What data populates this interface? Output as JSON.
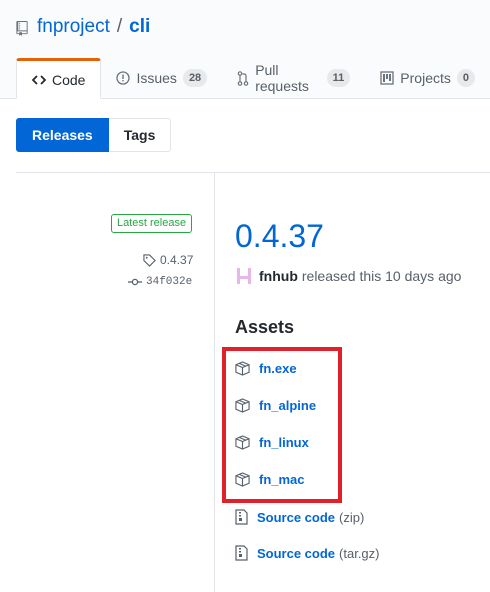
{
  "repo": {
    "owner": "fnproject",
    "separator": "/",
    "name": "cli"
  },
  "tabs": [
    {
      "label": "Code",
      "icon": "code-icon",
      "selected": true
    },
    {
      "label": "Issues",
      "count": "28",
      "icon": "issue-opened-icon"
    },
    {
      "label": "Pull requests",
      "count": "11",
      "icon": "git-pull-request-icon"
    },
    {
      "label": "Projects",
      "count": "0",
      "icon": "project-icon"
    }
  ],
  "subnav": {
    "releases": "Releases",
    "tags": "Tags"
  },
  "release": {
    "latest_label": "Latest release",
    "tag": "0.4.37",
    "commit": "34f032e",
    "version": "0.4.37",
    "user": "fnhub",
    "released_text": "released this 10 days ago"
  },
  "assets": {
    "title": "Assets",
    "items": [
      {
        "name": "fn.exe",
        "icon": "package-icon"
      },
      {
        "name": "fn_alpine",
        "icon": "package-icon"
      },
      {
        "name": "fn_linux",
        "icon": "package-icon"
      },
      {
        "name": "fn_mac",
        "icon": "package-icon"
      }
    ],
    "source": [
      {
        "name": "Source code",
        "ext": "(zip)",
        "icon": "file-zip-icon"
      },
      {
        "name": "Source code",
        "ext": "(tar.gz)",
        "icon": "file-zip-icon"
      }
    ]
  },
  "colors": {
    "link": "#0366d6",
    "accent_tab": "#e36209",
    "latest_green": "#28a745",
    "highlight_red": "#e0202a"
  }
}
